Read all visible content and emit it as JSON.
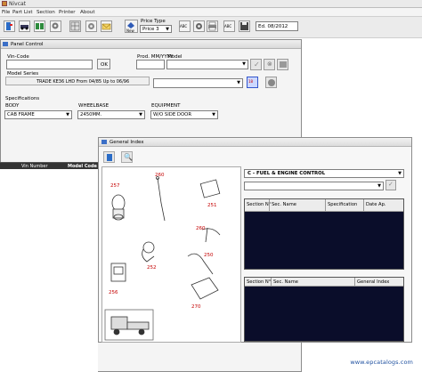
{
  "app": {
    "title": "Nivcat"
  },
  "menu": [
    "File",
    "Part List",
    "Section",
    "Printer",
    "About"
  ],
  "toolbar": {
    "price_type_label": "Price Type",
    "price_type_value": "Price 3",
    "edition": "Ed. 08/2012",
    "new_label": "New"
  },
  "panel_control": {
    "title": "Panel Control",
    "vin_code_label": "Vin-Code",
    "prod_label": "Prod. MM/YYYY",
    "model_label": "Model",
    "ok_label": "OK",
    "model_series_label": "Model Series",
    "model_series_value": "TRADE KE36 LHD From 04/85 Up to 06/96",
    "specifications_label": "Specifications",
    "body_label": "BODY",
    "body_value": "CAB FRAME",
    "wheelbase_label": "WHEELBASE",
    "wheelbase_value": "2450MM.",
    "equipment_label": "EQUIPMENT",
    "equipment_value": "W/O SIDE DOOR",
    "vin_number_header": "Vin Number",
    "model_code_header": "Model Code"
  },
  "general_index": {
    "title": "General Index",
    "section_select": "C - FUEL & ENGINE CONTROL",
    "table1_headers": [
      "Section N°",
      "Sec. Name",
      "Specification",
      "Date Ap."
    ],
    "table2_headers": [
      "Section N°",
      "Sec. Name",
      "General Index"
    ],
    "callouts": [
      "257",
      "260",
      "251",
      "260",
      "252",
      "250",
      "256",
      "270"
    ]
  },
  "watermark": "www.epcatalogs.com"
}
